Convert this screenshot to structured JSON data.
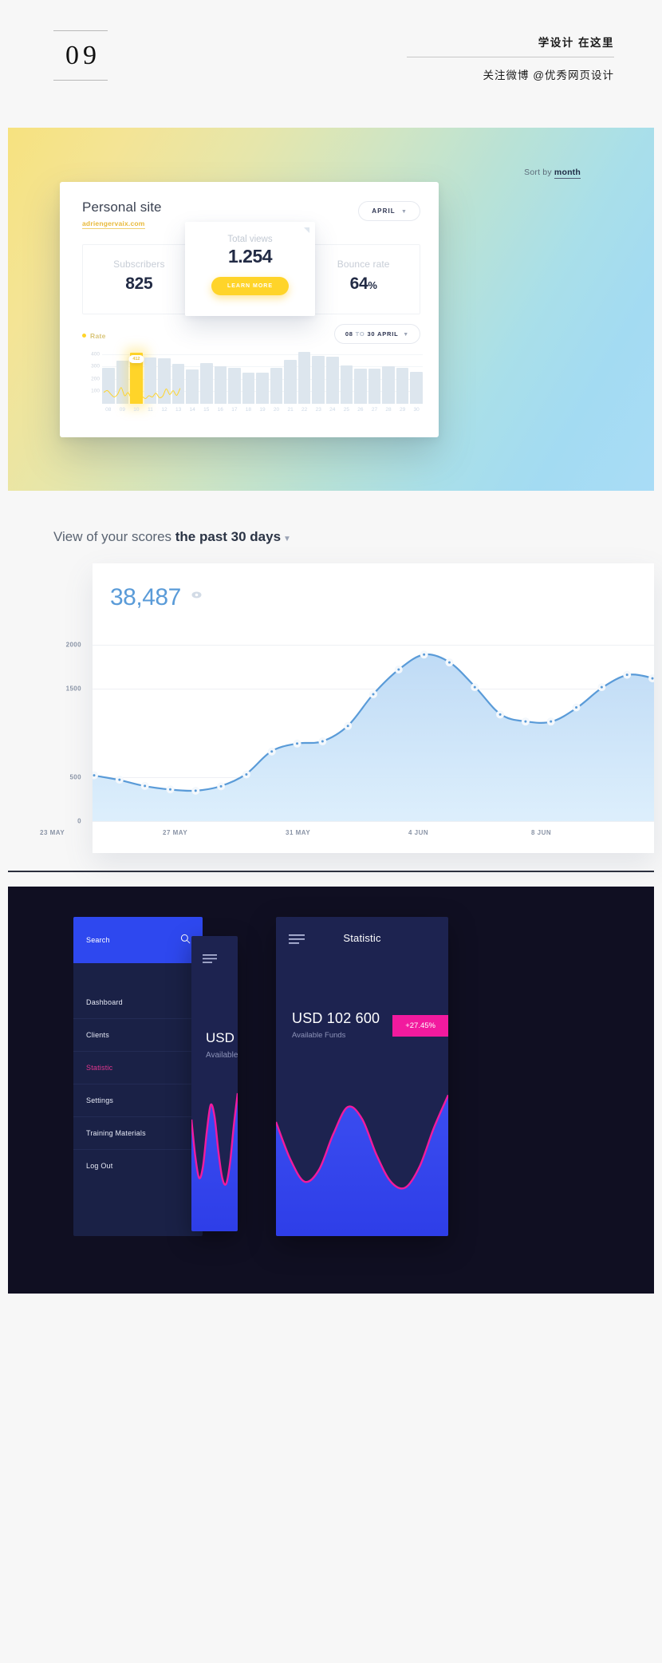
{
  "header": {
    "page_number": "09",
    "tagline_top": "学设计 在这里",
    "tagline_bottom": "关注微博 @优秀网页设计"
  },
  "hero": {
    "sort_prefix": "Sort by",
    "sort_value": "month",
    "card": {
      "title": "Personal site",
      "url": "adriengervaix.com",
      "period_button": "APRIL",
      "kpis": [
        {
          "label": "Subscribers",
          "value": "825",
          "suffix": ""
        },
        {
          "label": "Total views",
          "value": "1.254",
          "suffix": ""
        },
        {
          "label": "Bounce rate",
          "value": "64",
          "suffix": "%"
        }
      ],
      "popover": {
        "label": "Total views",
        "value": "1.254",
        "cta": "LEARN MORE"
      },
      "legend_label": "Rate",
      "range_start": "08",
      "range_to": "TO",
      "range_end": "30 APRIL"
    }
  },
  "scores": {
    "title_normal": "View of your scores",
    "title_bold": "the past 30 days",
    "big_number": "38,487"
  },
  "dark": {
    "sidebar": {
      "search_placeholder": "Search",
      "items": [
        {
          "label": "Dashboard",
          "active": false
        },
        {
          "label": "Clients",
          "active": false
        },
        {
          "label": "Statistic",
          "active": true
        },
        {
          "label": "Settings",
          "active": false
        },
        {
          "label": "Training Materials",
          "active": false
        },
        {
          "label": "Log Out",
          "active": false
        }
      ]
    },
    "mid_card": {
      "currency": "USD",
      "subtitle": "Available"
    },
    "stat_card": {
      "title": "Statistic",
      "amount": "USD 102 600",
      "subtitle": "Available Funds",
      "badge": "+27.45%"
    }
  },
  "colors": {
    "accent_yellow": "#ffd429",
    "accent_blue": "#5a9bd8",
    "accent_pink": "#f21a9e",
    "dark_navy": "#1d2350",
    "royal_blue": "#2e48ef"
  },
  "chart_data": [
    {
      "type": "bar",
      "title": "Rate",
      "xlabel": "",
      "ylabel": "",
      "ylim": [
        0,
        450
      ],
      "yticks": [
        100,
        200,
        300,
        400
      ],
      "categories": [
        "08",
        "09",
        "10",
        "11",
        "12",
        "13",
        "14",
        "15",
        "16",
        "17",
        "18",
        "19",
        "20",
        "21",
        "22",
        "23",
        "24",
        "25",
        "26",
        "27",
        "28",
        "29",
        "30"
      ],
      "values": [
        290,
        345,
        412,
        375,
        368,
        320,
        278,
        330,
        300,
        292,
        250,
        252,
        290,
        355,
        420,
        385,
        378,
        310,
        283,
        285,
        305,
        288,
        255
      ],
      "highlight_index": 2,
      "highlight_label": "412",
      "overlay_line": {
        "name": "Rate",
        "values": [
          92,
          107,
          78,
          55,
          78,
          130,
          65,
          90,
          38,
          25,
          45,
          58,
          42,
          65,
          55,
          85,
          50,
          62,
          120,
          75,
          105,
          68,
          125
        ]
      },
      "legend": [
        "Rate"
      ],
      "grid": true
    },
    {
      "type": "area",
      "title": "View of your scores the past 30 days",
      "total": "38,487",
      "xlabel": "",
      "ylabel": "",
      "ylim": [
        0,
        2200
      ],
      "yticks": [
        0,
        500,
        1500,
        2000
      ],
      "xticks": [
        "23 MAY",
        "27 MAY",
        "31 MAY",
        "4 JUN",
        "8 JUN"
      ],
      "x": [
        1,
        2,
        3,
        4,
        5,
        6,
        7,
        8,
        9,
        10,
        11,
        12,
        13,
        14,
        15,
        16,
        17,
        18,
        19,
        20,
        21,
        22,
        23
      ],
      "values": [
        520,
        470,
        400,
        360,
        345,
        395,
        530,
        790,
        880,
        905,
        1080,
        1440,
        1720,
        1890,
        1800,
        1520,
        1210,
        1130,
        1130,
        1290,
        1520,
        1660,
        1620
      ],
      "grid": true,
      "legend": []
    },
    {
      "type": "area",
      "title": "Statistic",
      "xlabel": "",
      "ylabel": "",
      "values": [
        70,
        45,
        30,
        38,
        62,
        80,
        72,
        48,
        30,
        26,
        40,
        66,
        88
      ],
      "grid": false,
      "legend": []
    }
  ]
}
